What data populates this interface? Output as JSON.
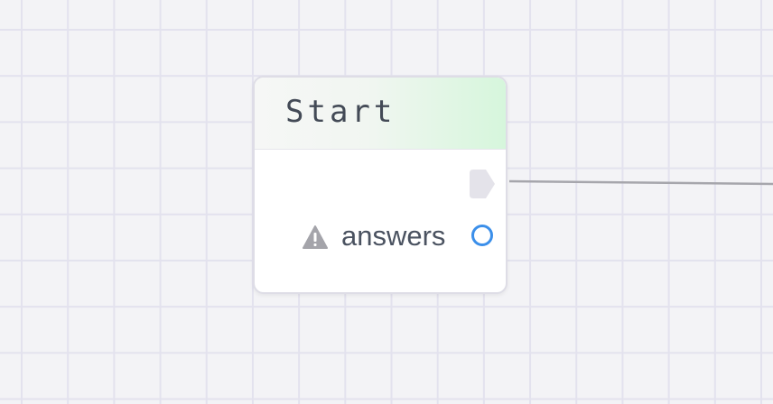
{
  "canvas": {
    "background_color": "#f3f3f6",
    "grid_color": "#e3e2ee"
  },
  "node": {
    "title": "Start",
    "header_accent_color": "#d6f6dc",
    "exec_output": {
      "icon": "exec-arrow-icon",
      "color": "#e4e3ea"
    },
    "outputs": [
      {
        "label": "answers",
        "warning_icon": "warning-triangle-icon",
        "port_icon": "data-port-ring-icon",
        "port_color": "#3b8fea"
      }
    ]
  },
  "connection": {
    "color": "#a6a6ac"
  }
}
